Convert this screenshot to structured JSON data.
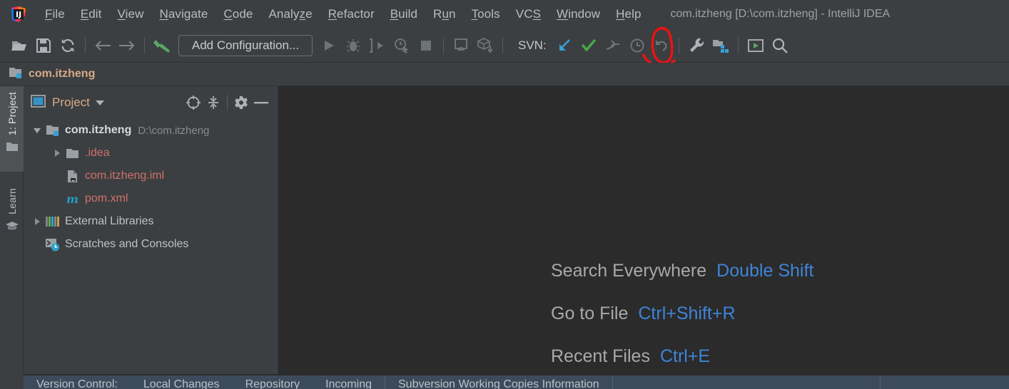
{
  "window": {
    "title": "com.itzheng [D:\\com.itzheng] - IntelliJ IDEA",
    "logo_icon": "intellij-idea-logo"
  },
  "menubar": {
    "items": [
      {
        "label": "File",
        "mnemonic": "F"
      },
      {
        "label": "Edit",
        "mnemonic": "E"
      },
      {
        "label": "View",
        "mnemonic": "V"
      },
      {
        "label": "Navigate",
        "mnemonic": "N"
      },
      {
        "label": "Code",
        "mnemonic": "C"
      },
      {
        "label": "Analyze",
        "mnemonic": "z"
      },
      {
        "label": "Refactor",
        "mnemonic": "R"
      },
      {
        "label": "Build",
        "mnemonic": "B"
      },
      {
        "label": "Run",
        "mnemonic": "u"
      },
      {
        "label": "Tools",
        "mnemonic": "T"
      },
      {
        "label": "VCS",
        "mnemonic": "S"
      },
      {
        "label": "Window",
        "mnemonic": "W"
      },
      {
        "label": "Help",
        "mnemonic": "H"
      }
    ]
  },
  "toolbar": {
    "open_icon": "open-folder-icon",
    "save_icon": "save-icon",
    "sync_icon": "sync-refresh-icon",
    "back_icon": "back-arrow-icon",
    "forward_icon": "forward-arrow-icon",
    "build_icon": "build-hammer-icon",
    "run_config_label": "Add Configuration...",
    "run_icon": "run-play-icon",
    "debug_icon": "debug-bug-icon",
    "run_with_coverage_icon": "run-with-coverage-icon",
    "profile_icon": "profile-clock-icon",
    "stop_icon": "stop-square-icon",
    "attach_icon": "attach-debugger-icon",
    "build_artifact_icon": "build-artifact-icon",
    "svn_label": "SVN:",
    "svn_update_icon": "svn-update-arrow-icon",
    "svn_commit_icon": "svn-commit-check-icon",
    "svn_push_icon": "svn-push-icon",
    "svn_history_icon": "svn-history-clock-icon",
    "svn_rollback_icon": "svn-rollback-undo-icon",
    "settings_icon": "settings-wrench-icon",
    "project_structure_icon": "project-structure-icon",
    "terminal_icon": "terminal-console-icon",
    "search_icon": "search-magnifier-icon"
  },
  "annotation": {
    "shape": "hand-drawn-red-oval",
    "color": "#ee1111",
    "target": "svn-commit-check-icon"
  },
  "breadcrumb": {
    "icon": "module-folder-icon",
    "label": "com.itzheng"
  },
  "toolstrip": {
    "items": [
      {
        "label": "1: Project",
        "icon": "project-folder-icon",
        "active": true
      },
      {
        "label": "Learn",
        "icon": "learn-graduation-cap-icon",
        "active": false
      }
    ]
  },
  "project_panel": {
    "view_icon": "project-view-icon",
    "title": "Project",
    "dropdown_icon": "chevron-down-icon",
    "locate_icon": "scroll-from-source-target-icon",
    "collapse_icon": "collapse-all-icon",
    "settings_icon": "gear-icon",
    "hide_icon": "hide-minus-icon",
    "tree": [
      {
        "label": "com.itzheng",
        "sublabel": "D:\\com.itzheng",
        "icon": "module-folder-icon",
        "arrow": "expanded",
        "indent": 0,
        "style": "bold"
      },
      {
        "label": ".idea",
        "sublabel": "",
        "icon": "folder-icon",
        "arrow": "collapsed",
        "indent": 1,
        "style": "red"
      },
      {
        "label": "com.itzheng.iml",
        "sublabel": "",
        "icon": "iml-module-file-icon",
        "arrow": "none",
        "indent": 1,
        "style": "red"
      },
      {
        "label": "pom.xml",
        "sublabel": "",
        "icon": "maven-pom-icon",
        "arrow": "none",
        "indent": 1,
        "style": "red"
      },
      {
        "label": "External Libraries",
        "sublabel": "",
        "icon": "external-libraries-icon",
        "arrow": "collapsed",
        "indent": 0,
        "style": "normal"
      },
      {
        "label": "Scratches and Consoles",
        "sublabel": "",
        "icon": "scratches-consoles-icon",
        "arrow": "none",
        "indent": 0,
        "style": "normal"
      }
    ]
  },
  "editor": {
    "hints": [
      {
        "name": "Search Everywhere",
        "key": "Double Shift"
      },
      {
        "name": "Go to File",
        "key": "Ctrl+Shift+R"
      },
      {
        "name": "Recent Files",
        "key": "Ctrl+E"
      }
    ]
  },
  "bottom_panel": {
    "tabs": [
      "Version Control:",
      "Local Changes",
      "Repository",
      "Incoming",
      "Subversion Working Copies Information"
    ]
  },
  "colors": {
    "chrome_bg": "#3c3f41",
    "editor_bg": "#2b2b2b",
    "accent_blue": "#3f84d8",
    "accent_orange": "#d7a987",
    "vcs_red": "#d0706b",
    "annotation_red": "#ee1111",
    "commit_green": "#49a849",
    "bottom_panel_bg": "#3c4b5c"
  }
}
